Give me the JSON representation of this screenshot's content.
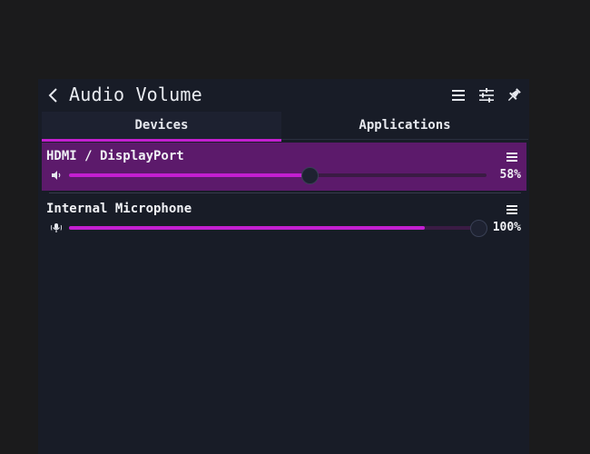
{
  "header": {
    "title": "Audio Volume"
  },
  "tabs": [
    {
      "label": "Devices",
      "active": true
    },
    {
      "label": "Applications",
      "active": false
    }
  ],
  "devices": [
    {
      "name": "HDMI / DisplayPort",
      "volume_label": "58%",
      "volume": 58,
      "icon": "speaker-icon",
      "active": true
    },
    {
      "name": "Internal Microphone",
      "volume_label": "100%",
      "volume": 100,
      "icon": "microphone-icon",
      "active": false
    }
  ],
  "colors": {
    "accent": "#c31fd0",
    "active_row": "#5c1a6b",
    "panel": "#181c27"
  }
}
